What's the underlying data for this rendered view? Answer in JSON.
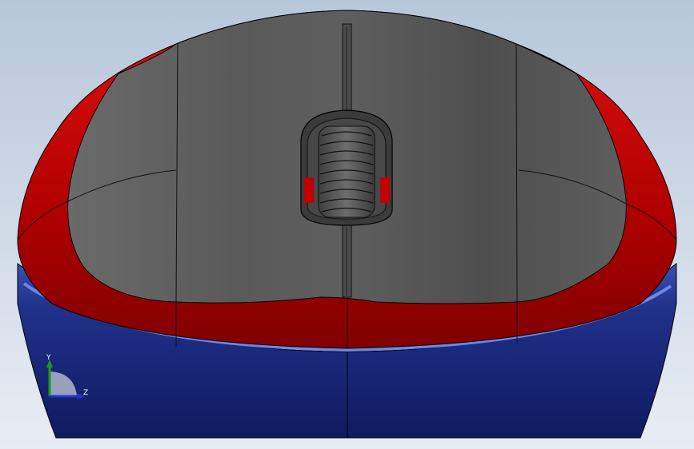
{
  "viewport": {
    "background_top": "#b9c9db",
    "background_bottom": "#e6ecf3"
  },
  "model": {
    "shell_color": "#5a5a5a",
    "trim_color": "#c40000",
    "base_color": "#1d2f86",
    "edge_color": "#000000"
  },
  "triad": {
    "y_label": "Y",
    "z_label": "Z",
    "y_color": "#1a9a1a",
    "z_color": "#2233cc"
  }
}
